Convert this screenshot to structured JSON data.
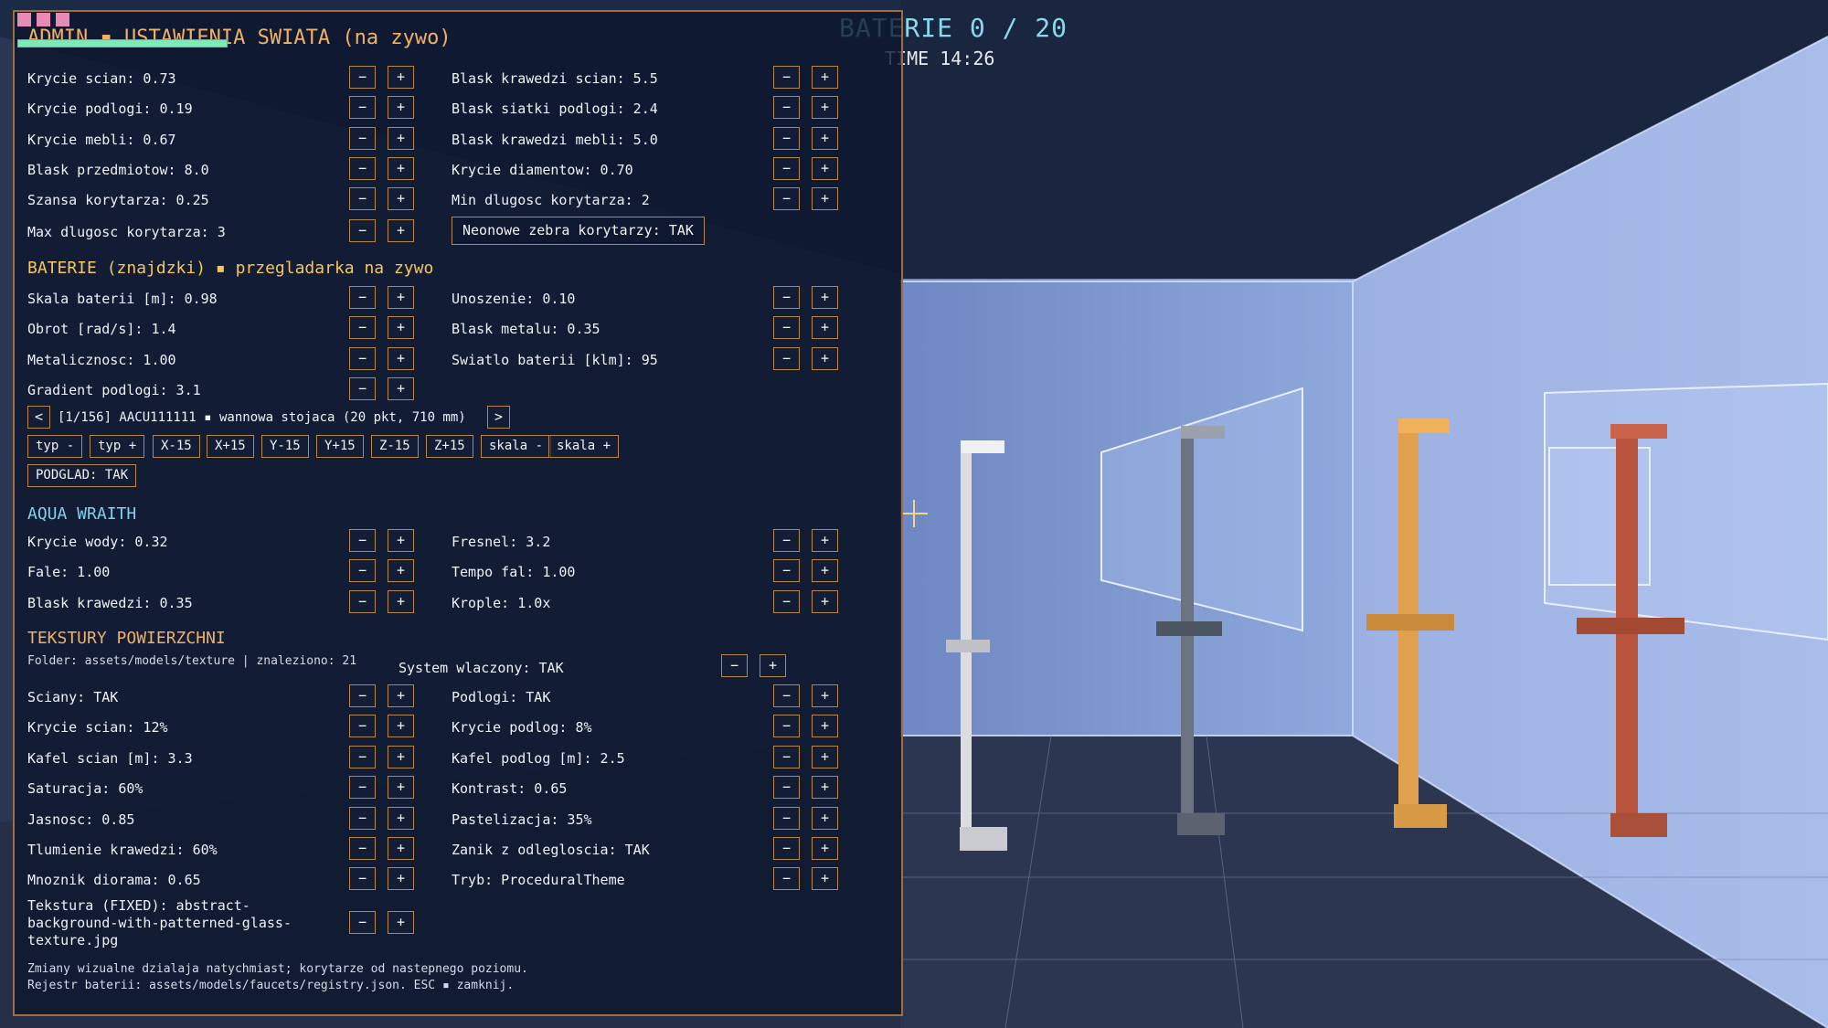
{
  "hud": {
    "batteries": "BATERIE 0 / 20",
    "time": "TIME 14:26"
  },
  "panel": {
    "title": "ADMIN ▪ USTAWIENIA SWIATA (na zywo)",
    "world": {
      "left": [
        "Krycie scian: 0.73",
        "Krycie podlogi: 0.19",
        "Krycie mebli: 0.67",
        "Blask przedmiotow: 8.0",
        "Szansa korytarza: 0.25",
        "Max dlugosc korytarza: 3"
      ],
      "right": [
        "Blask krawedzi scian: 5.5",
        "Blask siatki podlogi: 2.4",
        "Blask krawedzi mebli: 5.0",
        "Krycie diamentow: 0.70",
        "Min dlugosc korytarza: 2"
      ],
      "neon_toggle": "Neonowe zebra korytarzy: TAK"
    },
    "batteries": {
      "heading": "BATERIE (znajdzki) ▪ przegladarka na zywo",
      "left": [
        "Skala baterii [m]: 0.98",
        "Obrot [rad/s]: 1.4",
        "Metalicznosc: 1.00",
        "Gradient podlogi: 3.1"
      ],
      "right": [
        "Unoszenie: 0.10",
        "Blask metalu: 0.35",
        "Swiatlo baterii [klm]: 95"
      ],
      "browser": {
        "prev": "<",
        "label": "[1/156] AACU111111 ▪ wannowa stojaca (20 pkt, 710 mm)",
        "next": ">"
      },
      "tools": [
        "typ -",
        "typ +",
        "X-15",
        "X+15",
        "Y-15",
        "Y+15",
        "Z-15",
        "Z+15",
        "skala -",
        "skala +"
      ],
      "preview": "PODGLAD: TAK"
    },
    "aqua": {
      "heading": "AQUA WRAITH",
      "left": [
        "Krycie wody: 0.32",
        "Fale: 1.00",
        "Blask krawedzi: 0.35"
      ],
      "right": [
        "Fresnel: 3.2",
        "Tempo fal: 1.00",
        "Krople: 1.0x"
      ]
    },
    "textures": {
      "heading": "TEKSTURY POWIERZCHNI",
      "folder": "Folder: assets/models/texture  |  znaleziono: 21",
      "system": "System wlaczony: TAK",
      "left": [
        "Sciany: TAK",
        "Krycie scian: 12%",
        "Kafel scian [m]: 3.3",
        "Saturacja: 60%",
        "Jasnosc: 0.85",
        "Tlumienie krawedzi: 60%",
        "Mnoznik diorama: 0.65"
      ],
      "right": [
        "Podlogi: TAK",
        "Krycie podlog: 8%",
        "Kafel podlog [m]: 2.5",
        "Kontrast: 0.65",
        "Pastelizacja: 35%",
        "Zanik z odlegloscia: TAK",
        "Tryb: ProceduralTheme"
      ],
      "fixed": "Tekstura (FIXED): abstract-background-with-patterned-glass-texture.jpg"
    },
    "footer": {
      "line1": "Zmiany wizualne dzialaja natychmiast; korytarze od nastepnego poziomu.",
      "line2": "Rejestr baterii: assets/models/faucets/registry.json. ESC ▪ zamknij."
    },
    "minus": "−",
    "plus": "+"
  },
  "scene_colors": {
    "wall": "#8fa6d8",
    "floor": "#2f3a55",
    "ceiling": "#1e2a44",
    "faucet_white": "#dcdde0",
    "faucet_gray": "#5d6470",
    "faucet_gold": "#e0a04c",
    "faucet_red": "#b9553c"
  }
}
